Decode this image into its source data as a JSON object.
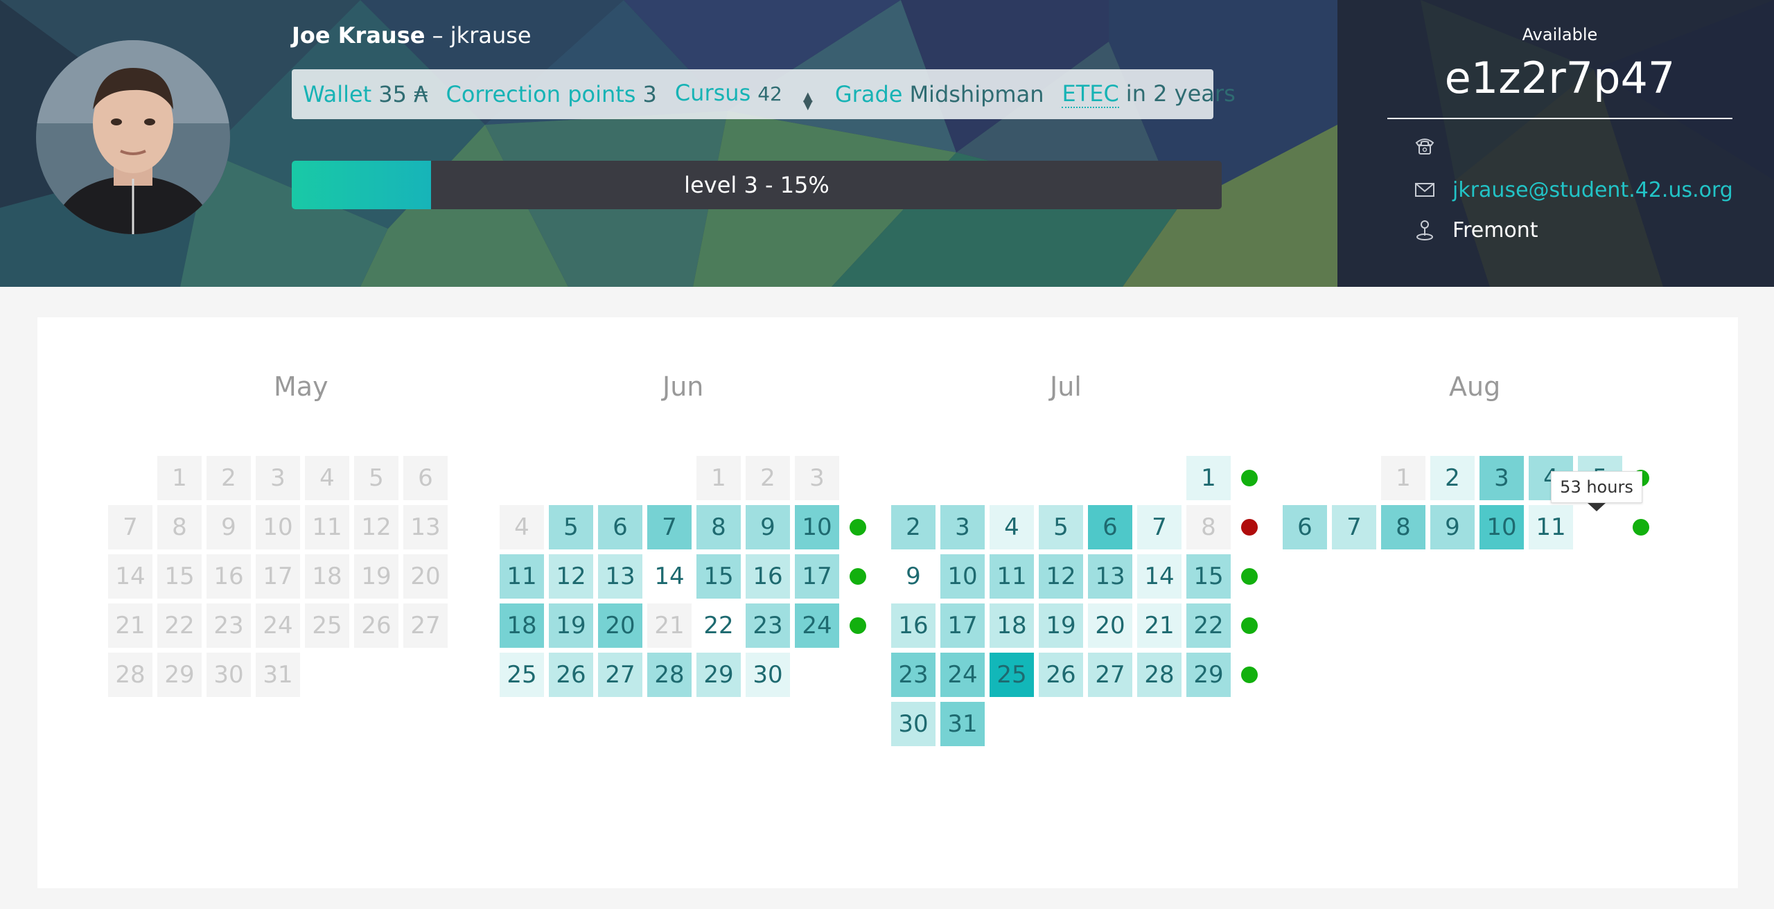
{
  "user": {
    "full_name": "Joe Krause",
    "separator": " – ",
    "login": "jkrause"
  },
  "stats": {
    "wallet_label": "Wallet",
    "wallet_value": "35 ₳",
    "correction_label": "Correction points",
    "correction_value": "3",
    "cursus_label": "Cursus",
    "cursus_value": "42",
    "grade_label": "Grade",
    "grade_value": "Midshipman",
    "etec_label": "ETEC",
    "etec_value": "in 2 years"
  },
  "level": {
    "label": "level 3 - 15%",
    "progress_fraction": 0.15
  },
  "location": {
    "status": "Available",
    "host": "e1z2r7p47"
  },
  "contact": {
    "phone": "",
    "email": "jkrause@student.42.us.org",
    "campus": "Fremont"
  },
  "icons": {
    "phone": "phone-icon",
    "mail": "mail-icon",
    "campus": "location-pin-icon",
    "stepper": "chevron-up-down-icon"
  },
  "colors": {
    "accent": "#17b3b5",
    "dot_ok": "#12b00e",
    "dot_bad": "#b00c0c"
  },
  "calendar": {
    "tooltip": "53 hours",
    "months": [
      {
        "name": "May",
        "weeks": [
          [
            null,
            {
              "d": "1",
              "lvl": "empty"
            },
            {
              "d": "2",
              "lvl": "empty"
            },
            {
              "d": "3",
              "lvl": "empty"
            },
            {
              "d": "4",
              "lvl": "empty"
            },
            {
              "d": "5",
              "lvl": "empty"
            },
            {
              "d": "6",
              "lvl": "empty"
            }
          ],
          [
            {
              "d": "7",
              "lvl": "empty"
            },
            {
              "d": "8",
              "lvl": "empty"
            },
            {
              "d": "9",
              "lvl": "empty"
            },
            {
              "d": "10",
              "lvl": "empty"
            },
            {
              "d": "11",
              "lvl": "empty"
            },
            {
              "d": "12",
              "lvl": "empty"
            },
            {
              "d": "13",
              "lvl": "empty"
            }
          ],
          [
            {
              "d": "14",
              "lvl": "empty"
            },
            {
              "d": "15",
              "lvl": "empty"
            },
            {
              "d": "16",
              "lvl": "empty"
            },
            {
              "d": "17",
              "lvl": "empty"
            },
            {
              "d": "18",
              "lvl": "empty"
            },
            {
              "d": "19",
              "lvl": "empty"
            },
            {
              "d": "20",
              "lvl": "empty"
            }
          ],
          [
            {
              "d": "21",
              "lvl": "empty"
            },
            {
              "d": "22",
              "lvl": "empty"
            },
            {
              "d": "23",
              "lvl": "empty"
            },
            {
              "d": "24",
              "lvl": "empty"
            },
            {
              "d": "25",
              "lvl": "empty"
            },
            {
              "d": "26",
              "lvl": "empty"
            },
            {
              "d": "27",
              "lvl": "empty"
            }
          ],
          [
            {
              "d": "28",
              "lvl": "empty"
            },
            {
              "d": "29",
              "lvl": "empty"
            },
            {
              "d": "30",
              "lvl": "empty"
            },
            {
              "d": "31",
              "lvl": "empty"
            },
            null,
            null,
            null
          ]
        ],
        "week_status": [
          null,
          null,
          null,
          null,
          null
        ]
      },
      {
        "name": "Jun",
        "weeks": [
          [
            null,
            null,
            null,
            null,
            {
              "d": "1",
              "lvl": "empty"
            },
            {
              "d": "2",
              "lvl": "empty"
            },
            {
              "d": "3",
              "lvl": "empty"
            }
          ],
          [
            {
              "d": "4",
              "lvl": "empty"
            },
            {
              "d": "5",
              "lvl": "l3"
            },
            {
              "d": "6",
              "lvl": "l3"
            },
            {
              "d": "7",
              "lvl": "l4"
            },
            {
              "d": "8",
              "lvl": "l3"
            },
            {
              "d": "9",
              "lvl": "l3"
            },
            {
              "d": "10",
              "lvl": "l4"
            }
          ],
          [
            {
              "d": "11",
              "lvl": "l3"
            },
            {
              "d": "12",
              "lvl": "l2"
            },
            {
              "d": "13",
              "lvl": "l2"
            },
            {
              "d": "14",
              "lvl": "l0"
            },
            {
              "d": "15",
              "lvl": "l3"
            },
            {
              "d": "16",
              "lvl": "l2"
            },
            {
              "d": "17",
              "lvl": "l3"
            }
          ],
          [
            {
              "d": "18",
              "lvl": "l4"
            },
            {
              "d": "19",
              "lvl": "l3"
            },
            {
              "d": "20",
              "lvl": "l4"
            },
            {
              "d": "21",
              "lvl": "empty"
            },
            {
              "d": "22",
              "lvl": "l0"
            },
            {
              "d": "23",
              "lvl": "l3"
            },
            {
              "d": "24",
              "lvl": "l4"
            }
          ],
          [
            {
              "d": "25",
              "lvl": "l1"
            },
            {
              "d": "26",
              "lvl": "l2"
            },
            {
              "d": "27",
              "lvl": "l2"
            },
            {
              "d": "28",
              "lvl": "l3"
            },
            {
              "d": "29",
              "lvl": "l2"
            },
            {
              "d": "30",
              "lvl": "l1"
            },
            null
          ]
        ],
        "week_status": [
          null,
          "ok",
          "ok",
          "ok",
          null
        ]
      },
      {
        "name": "Jul",
        "weeks": [
          [
            null,
            null,
            null,
            null,
            null,
            null,
            {
              "d": "1",
              "lvl": "l1"
            }
          ],
          [
            {
              "d": "2",
              "lvl": "l3"
            },
            {
              "d": "3",
              "lvl": "l3"
            },
            {
              "d": "4",
              "lvl": "l1"
            },
            {
              "d": "5",
              "lvl": "l2"
            },
            {
              "d": "6",
              "lvl": "l5"
            },
            {
              "d": "7",
              "lvl": "l1"
            },
            {
              "d": "8",
              "lvl": "empty"
            }
          ],
          [
            {
              "d": "9",
              "lvl": "l0"
            },
            {
              "d": "10",
              "lvl": "l3"
            },
            {
              "d": "11",
              "lvl": "l3"
            },
            {
              "d": "12",
              "lvl": "l3"
            },
            {
              "d": "13",
              "lvl": "l3"
            },
            {
              "d": "14",
              "lvl": "l1"
            },
            {
              "d": "15",
              "lvl": "l3"
            }
          ],
          [
            {
              "d": "16",
              "lvl": "l2"
            },
            {
              "d": "17",
              "lvl": "l3"
            },
            {
              "d": "18",
              "lvl": "l2"
            },
            {
              "d": "19",
              "lvl": "l2"
            },
            {
              "d": "20",
              "lvl": "l1"
            },
            {
              "d": "21",
              "lvl": "l1"
            },
            {
              "d": "22",
              "lvl": "l3"
            }
          ],
          [
            {
              "d": "23",
              "lvl": "l4"
            },
            {
              "d": "24",
              "lvl": "l4"
            },
            {
              "d": "25",
              "lvl": "l6"
            },
            {
              "d": "26",
              "lvl": "l2"
            },
            {
              "d": "27",
              "lvl": "l2"
            },
            {
              "d": "28",
              "lvl": "l2"
            },
            {
              "d": "29",
              "lvl": "l3"
            }
          ],
          [
            {
              "d": "30",
              "lvl": "l2"
            },
            {
              "d": "31",
              "lvl": "l4"
            },
            null,
            null,
            null,
            null,
            null
          ]
        ],
        "week_status": [
          "ok",
          "bad",
          "ok",
          "ok",
          "ok",
          null
        ]
      },
      {
        "name": "Aug",
        "weeks": [
          [
            null,
            null,
            {
              "d": "1",
              "lvl": "empty"
            },
            {
              "d": "2",
              "lvl": "l1"
            },
            {
              "d": "3",
              "lvl": "l4"
            },
            {
              "d": "4",
              "lvl": "l3"
            },
            {
              "d": "5",
              "lvl": "l2"
            }
          ],
          [
            {
              "d": "6",
              "lvl": "l3"
            },
            {
              "d": "7",
              "lvl": "l2"
            },
            {
              "d": "8",
              "lvl": "l4"
            },
            {
              "d": "9",
              "lvl": "l3"
            },
            {
              "d": "10",
              "lvl": "l5"
            },
            {
              "d": "11",
              "lvl": "l1"
            },
            null
          ]
        ],
        "week_status": [
          "ok",
          "ok"
        ]
      }
    ]
  }
}
